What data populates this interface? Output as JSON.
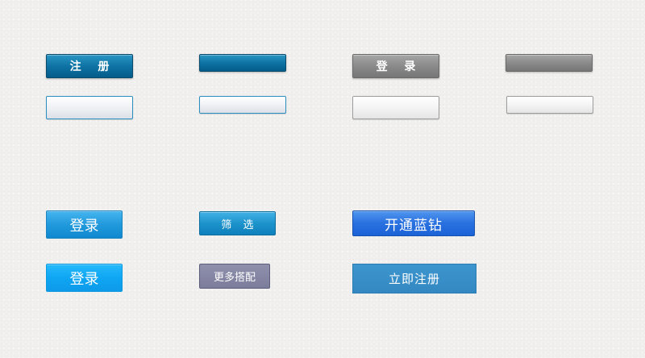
{
  "row1": {
    "register_dark_label": "注 册",
    "login_gray_label": "登 录"
  },
  "row3": {
    "login_label": "登录",
    "filter_label": "筛 选",
    "open_vip_label": "开通蓝钻"
  },
  "row4": {
    "login_label": "登录",
    "more_label": "更多搭配",
    "register_now_label": "立即注册"
  }
}
